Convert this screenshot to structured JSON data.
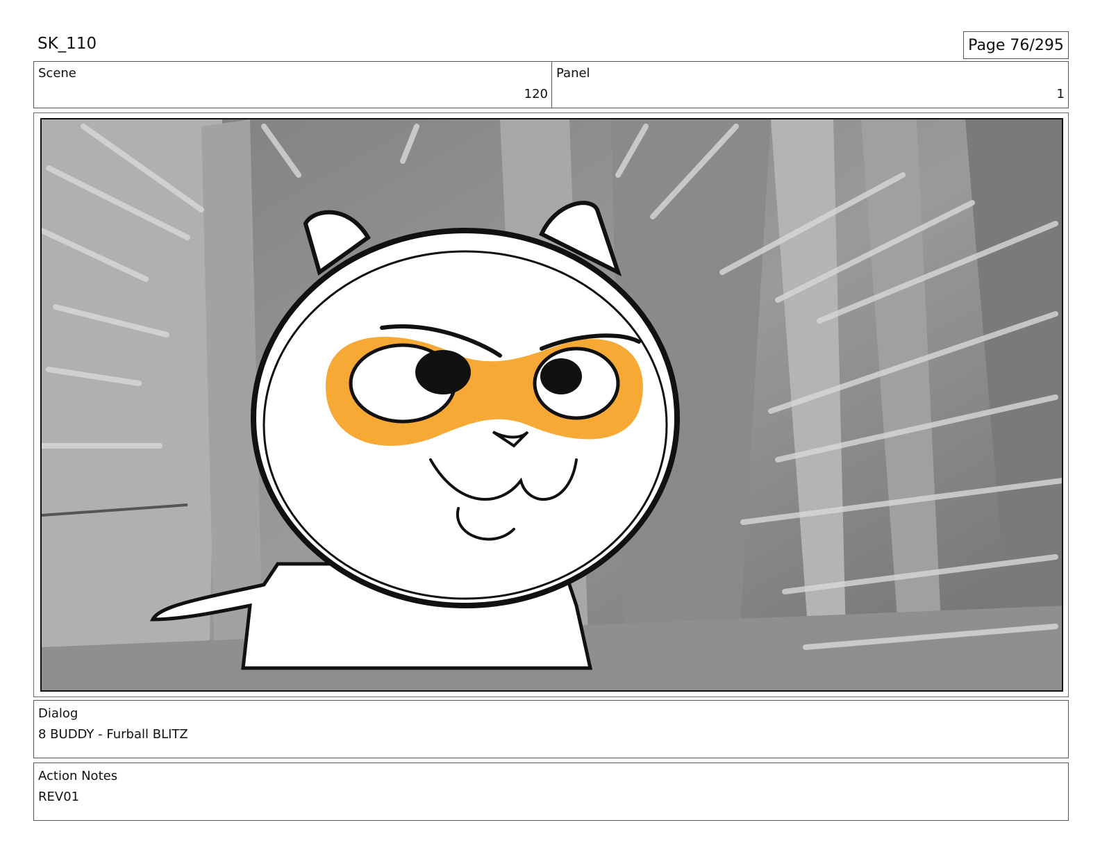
{
  "doc_title": "SK_110",
  "page_label": "Page 76/295",
  "scene": {
    "label": "Scene",
    "value": "120"
  },
  "panel": {
    "label": "Panel",
    "value": "1"
  },
  "dialog": {
    "label": "Dialog",
    "text": "8 BUDDY - Furball BLITZ"
  },
  "action_notes": {
    "label": "Action Notes",
    "text": "REV01"
  },
  "colors": {
    "mask": "#F7A936",
    "background_gray": "#8c8c8c"
  }
}
